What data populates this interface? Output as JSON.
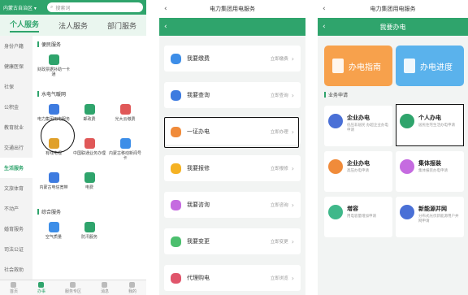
{
  "panel1": {
    "location": "内蒙古自治区 ▾",
    "search_placeholder": "搜索词",
    "tabs": [
      "个人服务",
      "法人服务",
      "部门服务"
    ],
    "sidebar": [
      "身份户籍",
      "健康医保",
      "社保",
      "公积金",
      "教育就业",
      "交通出行",
      "生活服务",
      "文旅体育",
      "不动产",
      "婚育服务",
      "司法公证",
      "社会救助"
    ],
    "sections": [
      {
        "title": "便民服务",
        "items": [
          "财政票据补助一卡通"
        ]
      },
      {
        "title": "水电气暖网",
        "items": [
          "电力集团用电服务",
          "邮政费",
          "光大云缴费",
          "有线电视",
          "中国联通业务办理",
          "内蒙古移动新闻号卡",
          "内蒙古电信宽带",
          "电费"
        ]
      },
      {
        "title": "综合服务",
        "items": [
          "空气质量",
          "防汛服务"
        ]
      }
    ],
    "bottom_nav": [
      "首页",
      "办事",
      "服务专区",
      "消息",
      "我的"
    ]
  },
  "panel2": {
    "title": "电力集团用电服务",
    "rows": [
      {
        "label": "我要缴费",
        "action": "立即缴费",
        "color": "#3d8ee8"
      },
      {
        "label": "我要查询",
        "action": "立即查询",
        "color": "#3d7be0"
      },
      {
        "label": "一证办电",
        "action": "立即办理",
        "color": "#f08b3a"
      },
      {
        "label": "我要报修",
        "action": "立即报修",
        "color": "#f5b223"
      },
      {
        "label": "我要咨询",
        "action": "立即咨询",
        "color": "#c56be0"
      },
      {
        "label": "我要变更",
        "action": "立即变更",
        "color": "#4cbf6e"
      },
      {
        "label": "代理购电",
        "action": "立即浏览",
        "color": "#e0556b"
      }
    ]
  },
  "panel3": {
    "title": "电力集团用电服务",
    "subtitle": "我要办电",
    "banners": [
      {
        "label": "办电指南",
        "color": "#f7a14c"
      },
      {
        "label": "办电进度",
        "color": "#5ab2ec"
      }
    ],
    "section": "业务申请",
    "cards": [
      {
        "title": "企业办电",
        "desc": "低压非居民 办超企业办电申请",
        "color": "#4a70d6"
      },
      {
        "title": "个人办电",
        "desc": "居民住宅生活办电申请",
        "color": "#2fa46c"
      },
      {
        "title": "企业办电",
        "desc": "高压办电申请",
        "color": "#f08b3a"
      },
      {
        "title": "集体报装",
        "desc": "集体报装办电申请",
        "color": "#c56be0"
      },
      {
        "title": "增容",
        "desc": "用电容量增加申请",
        "color": "#3fb88a"
      },
      {
        "title": "新能源并网",
        "desc": "分布式光伏新能源用户并网申请",
        "color": "#4a70d6"
      }
    ]
  }
}
